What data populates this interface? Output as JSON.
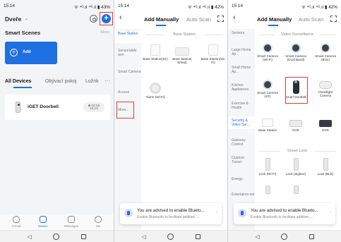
{
  "colors": {
    "accent": "#1e6fe0",
    "highlight": "#e53935"
  },
  "status": {
    "p1_time": "15:14",
    "p1_icons": "ᯤ ⁴ᴳ.ıl ⁴ᴳ.ıl ▮ 43%",
    "p23_time": "15:14",
    "p23_icons": "ᯤ ⁴ᴳ.ıl ⁴ᴳ.ıl ▮ 42%",
    "p1_extra": ""
  },
  "phone1": {
    "home_name": "Dveře",
    "scenes_title": "Smart Scenes",
    "more": "More",
    "add_scene": "Add",
    "tabs": {
      "all": "All Devices",
      "room1": "Obývací pokoj",
      "room2": "Ložnk"
    },
    "tab_more": "···",
    "device": {
      "name": "iGET Doorbell",
      "time_line1": "10:19",
      "time_line2": "15:10"
    },
    "bottom_tabs": {
      "armed": "Armed",
      "device": "Device",
      "messages": "Messages",
      "me": "Me"
    }
  },
  "header": {
    "tab_manual": "Add Manually",
    "tab_scan": "Auto Scan"
  },
  "phone2": {
    "sidebar": [
      "Base Station",
      "Sensors&Al arm",
      "Smart Camera",
      "Access",
      "More..."
    ],
    "section_title": "Base Station",
    "devices": [
      "Base Station(4G)",
      "Base Station( Wired)",
      "Base Station(Wi-Fi)",
      "Alarm (Wi-Fi)"
    ]
  },
  "phone3": {
    "sidebar": [
      "Sensors",
      "Large Home Ap...",
      "Small Home Ap...",
      "Kitchen Appliances",
      "Exercise & Health",
      "Security & Video Sur...",
      "Gateway Control",
      "Outdoor Travel",
      "Energy",
      "Entertainm ent"
    ],
    "section1": "Video Surveillance",
    "cams": [
      "Smart Camera (Wi-Fi)",
      "Smart Camera (Dual Band)",
      "Smart Camera (BLE)",
      "Smart Camera (4G)",
      "Smart Doorbell",
      "Floodlight Camera",
      "Base Station",
      "NVR",
      "DVR"
    ],
    "section2": "Smart Lock",
    "locks": [
      "Lock (Wi-Fi)",
      "Lock (Zigbee)",
      "Lock (BLE)"
    ]
  },
  "toast": {
    "title": "You are advised to enable Blueto...",
    "body": "Enable Bluetooth to facilitate addition ..."
  },
  "icons": {
    "back": "back-arrow-icon",
    "add": "plus-icon",
    "scan": "scan-icon",
    "close": "close-icon"
  }
}
